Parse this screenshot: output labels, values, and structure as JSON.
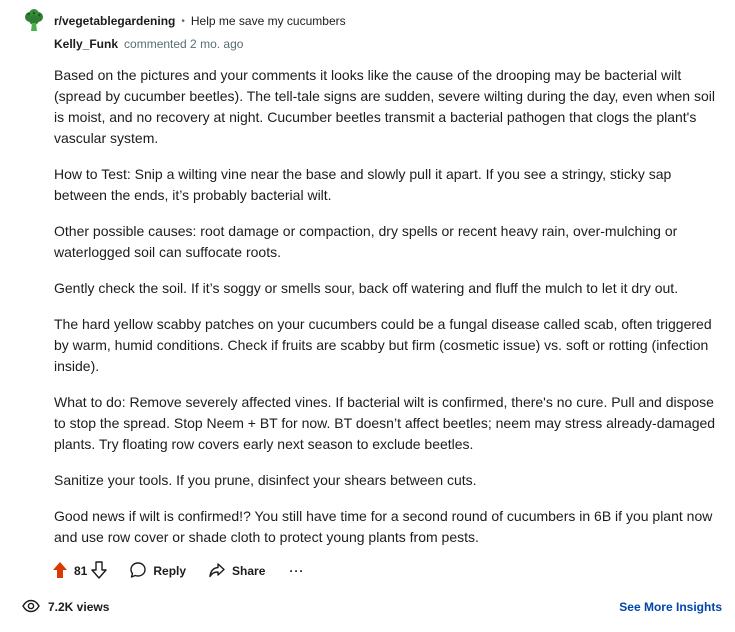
{
  "header": {
    "subreddit": "r/vegetablegardening",
    "separator": "•",
    "post_title": "Help me save my cucumbers"
  },
  "comment": {
    "author": "Kelly_Funk",
    "meta": "commented 2 mo. ago",
    "paragraphs": [
      "Based on the pictures and your comments it looks like the cause of the drooping may be bacterial wilt (spread by cucumber beetles). The tell-tale signs are sudden, severe wilting during the day, even when soil is moist, and no recovery at night. Cucumber beetles transmit a bacterial pathogen that clogs the plant's vascular system.",
      "How to Test: Snip a wilting vine near the base and slowly pull it apart. If you see a stringy, sticky sap between the ends, it’s probably bacterial wilt.",
      "Other possible causes: root damage or compaction, dry spells or recent heavy rain, over-mulching or waterlogged soil can suffocate roots.",
      "Gently check the soil. If it’s soggy or smells sour, back off watering and fluff the mulch to let it dry out.",
      "The hard yellow scabby patches on your cucumbers could be a fungal disease called scab, often triggered by warm, humid conditions. Check if fruits are scabby but firm (cosmetic issue) vs. soft or rotting (infection inside).",
      "What to do: Remove severely affected vines. If bacterial wilt is confirmed, there's no cure. Pull and dispose to stop the spread. Stop Neem + BT for now.  BT doesn’t affect beetles; neem may stress already-damaged plants. Try floating row covers early next season to exclude beetles.",
      "Sanitize your tools.  If you prune, disinfect your shears between cuts.",
      "Good news if wilt is confirmed!? You still have time for a second round of cucumbers in 6B if you plant now and use row cover or shade cloth to protect young plants from pests."
    ]
  },
  "actions": {
    "vote_count": "81",
    "reply_label": "Reply",
    "share_label": "Share",
    "more_label": "···"
  },
  "footer": {
    "views": "7.2K views",
    "insights_label": "See More Insights"
  },
  "colors": {
    "upvote": "#d93a00",
    "link": "#0045ac",
    "muted": "#576f76",
    "icon_green": "#2e7d32"
  },
  "icons": {
    "subreddit": "broccoli-icon",
    "upvote": "upvote-arrow-icon",
    "downvote": "downvote-arrow-icon",
    "reply": "speech-bubble-icon",
    "share": "share-arrow-icon",
    "views": "eye-icon"
  }
}
